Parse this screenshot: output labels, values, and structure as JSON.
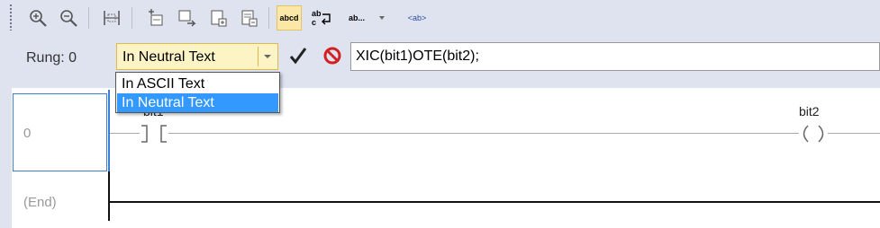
{
  "toolbar": {
    "items": [
      {
        "icon": "zoom-in-icon"
      },
      {
        "icon": "zoom-out-icon"
      },
      {
        "icon": "rung-frame-icon"
      },
      {
        "icon": "add-rung-above-icon"
      },
      {
        "icon": "add-rung-below-icon"
      },
      {
        "icon": "add-branch-icon"
      },
      {
        "icon": "add-instruction-icon"
      },
      {
        "icon": "text-mode-icon",
        "label": "abcd",
        "active": true
      },
      {
        "icon": "replace-icon",
        "label": "ab"
      },
      {
        "icon": "display-options-icon",
        "label": "ab..."
      },
      {
        "icon": "tag-description-icon",
        "label": "<ab>"
      }
    ]
  },
  "rung_bar": {
    "rung_label": "Rung: 0",
    "format_select": {
      "value": "In Neutral Text",
      "options": [
        "In ASCII Text",
        "In Neutral Text"
      ],
      "selected_index": 1
    },
    "rung_text": "XIC(bit1)OTE(bit2);"
  },
  "ladder": {
    "rungs": [
      {
        "number": "0",
        "xic_tag": "bit1",
        "ote_tag": "bit2"
      },
      {
        "number": "(End)"
      }
    ]
  },
  "colors": {
    "toolbar_bg": "#dfe3f0",
    "select_bg": "#fdf4c5",
    "selection": "#3399ff",
    "rail_accent": "#3d7fd6",
    "cancel_red": "#d32020"
  }
}
